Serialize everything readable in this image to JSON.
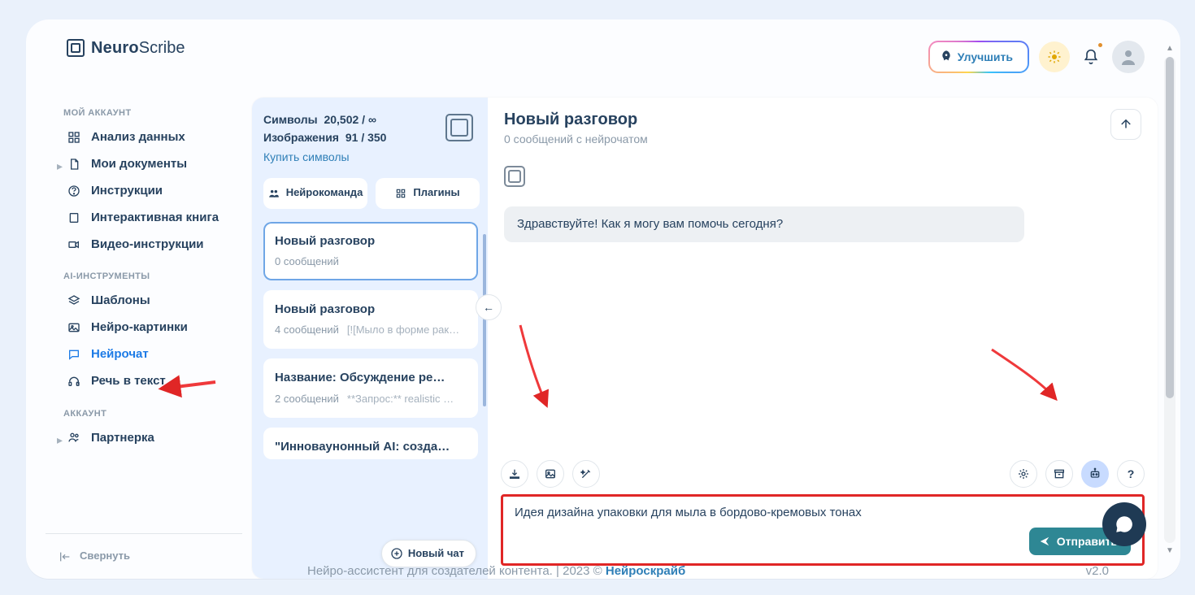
{
  "header": {
    "brand_strong": "Neuro",
    "brand_thin": "Scribe",
    "upgrade": "Улучшить"
  },
  "sidebar": {
    "section1": "МОЙ АККАУНТ",
    "item_analytics": "Анализ данных",
    "item_docs": "Мои документы",
    "item_instructions": "Инструкции",
    "item_book": "Интерактивная книга",
    "item_video": "Видео-инструкции",
    "section2": "AI-ИНСТРУМЕНТЫ",
    "item_templates": "Шаблоны",
    "item_images": "Нейро-картинки",
    "item_chat": "Нейрочат",
    "item_speech": "Речь в текст",
    "section3": "АККАУНТ",
    "item_partner": "Партнерка",
    "collapse": "Свернуть"
  },
  "quota": {
    "symbols_label": "Символы",
    "symbols_value": "20,502 / ∞",
    "images_label": "Изображения",
    "images_value": "91 / 350",
    "buy": "Купить символы"
  },
  "tabs": {
    "team": "Нейрокоманда",
    "plugins": "Плагины"
  },
  "conversations": [
    {
      "title": "Новый разговор",
      "count": "0 сообщений",
      "preview": ""
    },
    {
      "title": "Новый разговор",
      "count": "4 сообщений",
      "preview": "[![Мыло в форме рак…"
    },
    {
      "title": "Название: Обсуждение ре…",
      "count": "2 сообщений",
      "preview": "**Запрос:** realistic …"
    },
    {
      "title": "\"Инноваунонный AI: созда…",
      "count": "",
      "preview": ""
    }
  ],
  "new_chat": "Новый чат",
  "chat": {
    "title": "Новый разговор",
    "subtitle": "0 сообщений с нейрочатом",
    "greeting": "Здравствуйте! Как я могу вам помочь сегодня?"
  },
  "composer": {
    "text": "Идея дизайна упаковки для мыла в бордово-кремовых тонах",
    "send": "Отправить"
  },
  "footer": {
    "tagline": "Нейро-ассистент для создателей контента.",
    "copyright": "| 2023 ©",
    "brand": "Нейроскрайб",
    "version": "v2.0"
  }
}
